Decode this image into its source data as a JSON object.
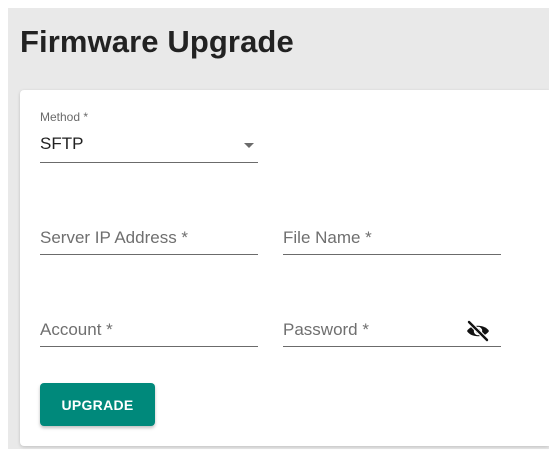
{
  "page": {
    "title": "Firmware Upgrade"
  },
  "form": {
    "method": {
      "label": "Method *",
      "value": "SFTP"
    },
    "server_ip": {
      "placeholder": "Server IP Address *",
      "value": ""
    },
    "file_name": {
      "placeholder": "File Name *",
      "value": ""
    },
    "account": {
      "placeholder": "Account *",
      "value": ""
    },
    "password": {
      "placeholder": "Password *",
      "value": "",
      "visibility_icon": "eye-off-icon"
    }
  },
  "actions": {
    "upgrade_label": "UPGRADE"
  },
  "colors": {
    "accent": "#00897b",
    "page_background": "#e9e9e9",
    "card_background": "#ffffff"
  }
}
